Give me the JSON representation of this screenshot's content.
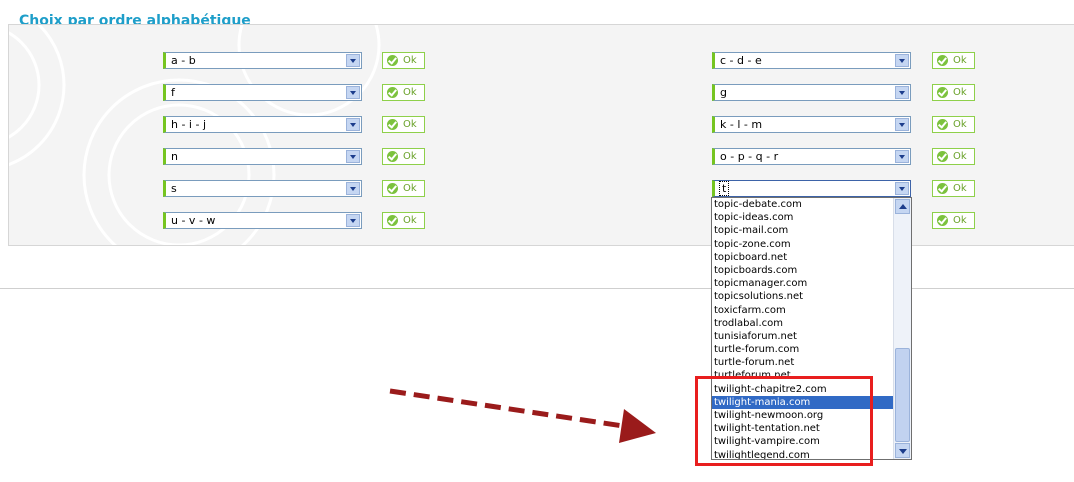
{
  "section_title": "Choix par ordre alphabétique",
  "ok_label": "Ok",
  "left_selects": [
    "a - b",
    "f",
    "h - i - j",
    "n",
    "s",
    "u - v - w"
  ],
  "right_selects": [
    "c - d - e",
    "g",
    "k - l - m",
    "o - p - q - r",
    "t"
  ],
  "dropdown": {
    "options": [
      "topic-debate.com",
      "topic-ideas.com",
      "topic-mail.com",
      "topic-zone.com",
      "topicboard.net",
      "topicboards.com",
      "topicmanager.com",
      "topicsolutions.net",
      "toxicfarm.com",
      "trodlabal.com",
      "tunisiaforum.net",
      "turtle-forum.com",
      "turtle-forum.net",
      "turtleforum.net",
      "twilight-chapitre2.com",
      "twilight-mania.com",
      "twilight-newmoon.org",
      "twilight-tentation.net",
      "twilight-vampire.com",
      "twilightlegend.com"
    ],
    "selected": "twilight-mania.com"
  },
  "colors": {
    "title": "#1e9ec9",
    "accent_green": "#76c521",
    "highlight_red": "#e81e1e",
    "arrow": "#9a1b1b",
    "selection": "#316ac5"
  }
}
